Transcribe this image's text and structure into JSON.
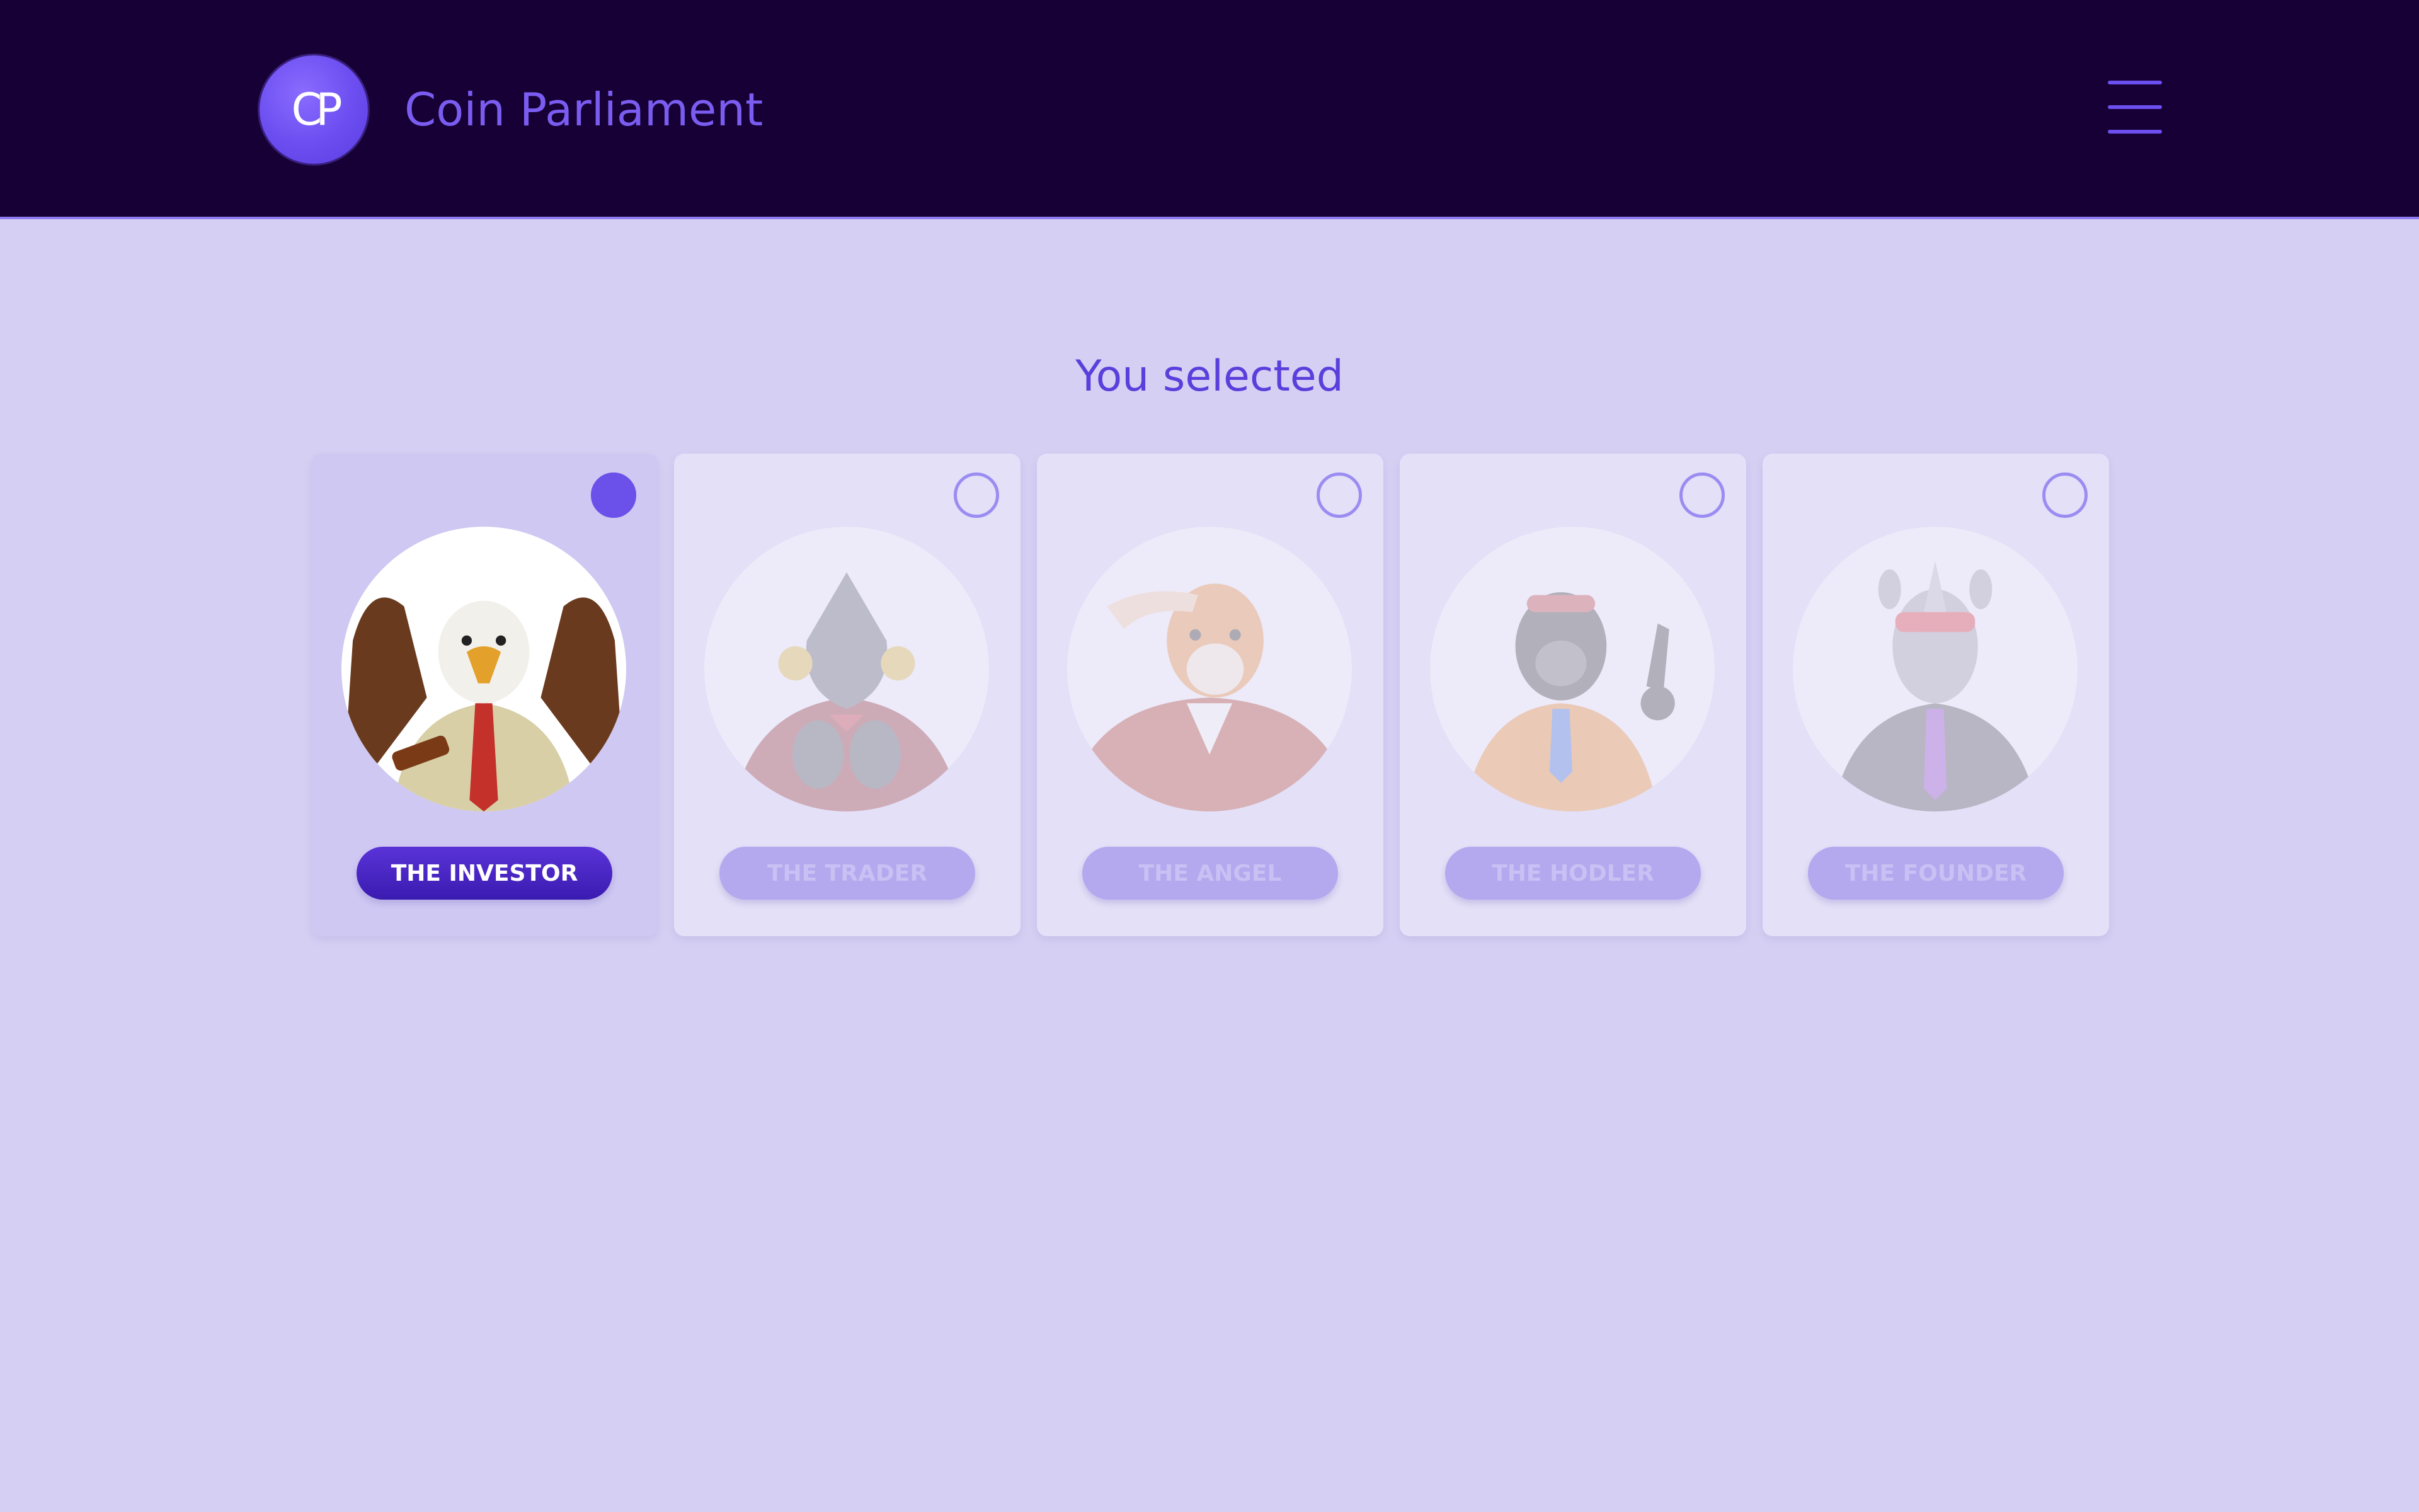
{
  "header": {
    "logo_text": "CP",
    "app_title": "Coin Parliament",
    "menu_icon": "hamburger-menu-icon"
  },
  "main": {
    "heading": "You selected",
    "cards": [
      {
        "name": "THE INVESTOR",
        "selected": true,
        "avatar_icon": "eagle-avatar-icon"
      },
      {
        "name": "THE TRADER",
        "selected": false,
        "avatar_icon": "shark-avatar-icon"
      },
      {
        "name": "THE ANGEL",
        "selected": false,
        "avatar_icon": "tiger-avatar-icon"
      },
      {
        "name": "THE HODLER",
        "selected": false,
        "avatar_icon": "gorilla-avatar-icon"
      },
      {
        "name": "THE FOUNDER",
        "selected": false,
        "avatar_icon": "rhino-avatar-icon"
      }
    ]
  },
  "colors": {
    "header_bg": "#160035",
    "page_bg": "#d5d0f3",
    "accent": "#6b50ea",
    "title": "#7a5cf0"
  }
}
